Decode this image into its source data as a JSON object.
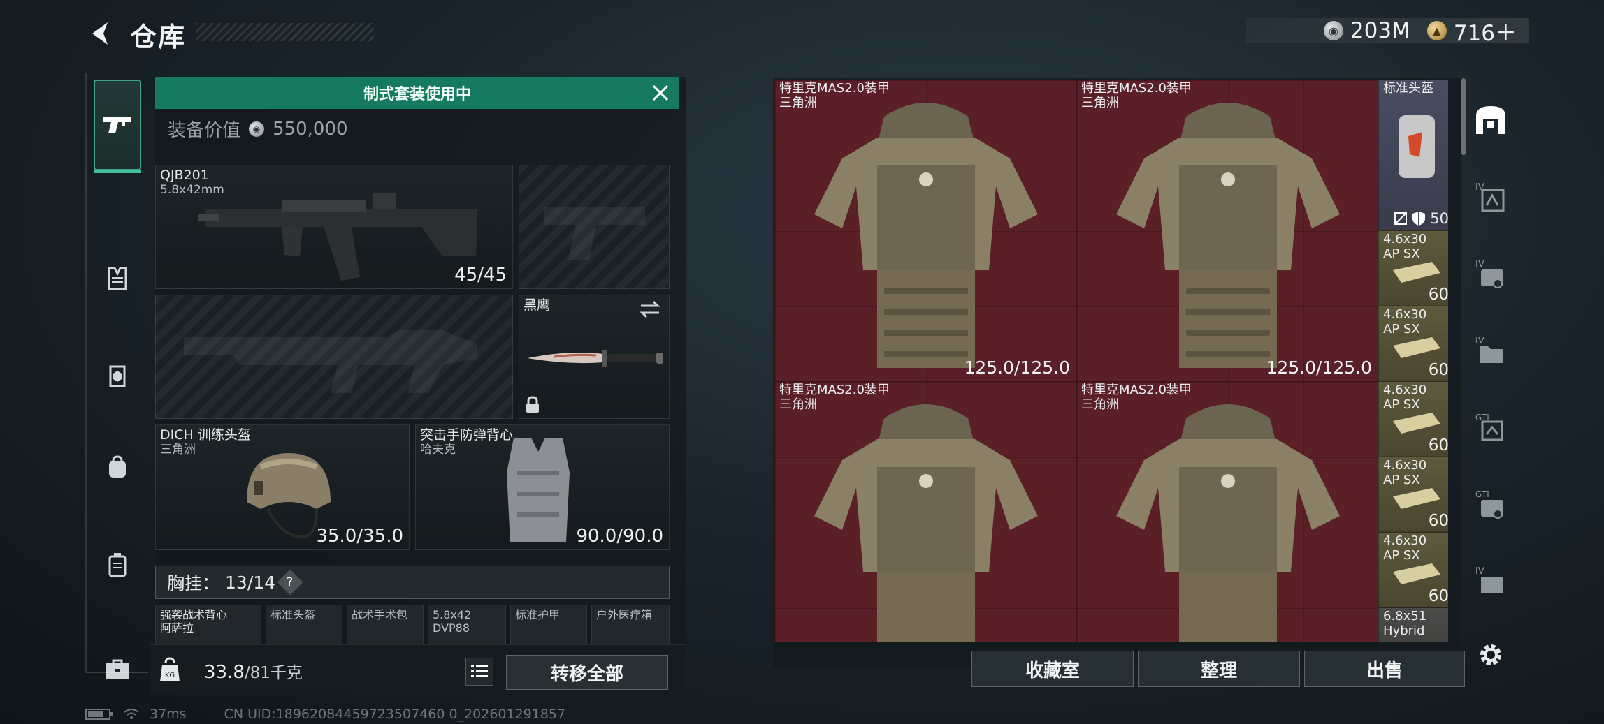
{
  "header": {
    "title": "仓库",
    "currency": [
      {
        "icon": "silver-coin-icon",
        "value": "203M"
      },
      {
        "icon": "gold-coin-icon",
        "value": "716＋"
      }
    ]
  },
  "sidebar": {
    "items": [
      {
        "name": "pistol-icon",
        "active": true
      },
      {
        "name": "vest-icon"
      },
      {
        "name": "armor-icon"
      },
      {
        "name": "backpack-icon"
      },
      {
        "name": "chest-rig-icon"
      },
      {
        "name": "toolbox-icon"
      }
    ]
  },
  "loadout": {
    "banner": "制式套装使用中",
    "value_label": "装备价值",
    "value": "550,000",
    "primary": {
      "name": "QJB201",
      "sub": "5.8x42mm",
      "value": "45/45"
    },
    "knife": {
      "name": "黑鹰"
    },
    "helmet": {
      "name": "DICH 训练头盔",
      "sub": "三角洲",
      "value": "35.0/35.0"
    },
    "armor": {
      "name": "突击手防弹背心",
      "sub": "哈夫克",
      "value": "90.0/90.0"
    },
    "chest_rig": {
      "label": "胸挂：",
      "value": "13/14",
      "help": "?"
    },
    "mini_items": [
      {
        "name": "强袭战术背心",
        "sub": "阿萨拉"
      },
      {
        "name": "标准头盔",
        "sub": ""
      },
      {
        "name": "战术手术包",
        "sub": ""
      },
      {
        "name": "5.8x42",
        "sub": "DVP88"
      },
      {
        "name": "标准护甲",
        "sub": ""
      },
      {
        "name": "户外医疗箱",
        "sub": ""
      }
    ],
    "weight": {
      "current": "33.8",
      "max": "/81千克"
    },
    "transfer_label": "转移全部"
  },
  "storage": {
    "armors": [
      {
        "name": "特里克MAS2.0装甲",
        "sub": "三角洲",
        "value": "125.0/125.0"
      },
      {
        "name": "特里克MAS2.0装甲",
        "sub": "三角洲",
        "value": "125.0/125.0"
      },
      {
        "name": "特里克MAS2.0装甲",
        "sub": "三角洲",
        "value": ""
      },
      {
        "name": "特里克MAS2.0装甲",
        "sub": "三角洲",
        "value": ""
      }
    ],
    "helmet": {
      "name": "标准头盔",
      "durability": "50"
    },
    "ammo": [
      {
        "name": "4.6x30",
        "sub": "AP SX",
        "qty": "60"
      },
      {
        "name": "4.6x30",
        "sub": "AP SX",
        "qty": "60"
      },
      {
        "name": "4.6x30",
        "sub": "AP SX",
        "qty": "60"
      },
      {
        "name": "4.6x30",
        "sub": "AP SX",
        "qty": "60"
      },
      {
        "name": "4.6x30",
        "sub": "AP SX",
        "qty": "60"
      },
      {
        "name": "6.8x51",
        "sub": "Hybrid",
        "qty": ""
      }
    ],
    "buttons": {
      "collection": "收藏室",
      "sort": "整理",
      "sell": "出售"
    }
  },
  "right_sidebar": {
    "items": [
      "safe-box-icon",
      "backpack-tier-IV-icon",
      "case-tier-IV-icon",
      "folder-tier-IV-icon",
      "box-GTI-icon",
      "case-GTI-icon",
      "box-tier-IV-icon",
      "settings-icon"
    ]
  },
  "status": {
    "ping": "37ms",
    "uid": "CN UID:18962084459723507460 0_202601291857"
  },
  "colors": {
    "accent": "#167a60",
    "stash_red": "#5a1f27",
    "ammo_olive": "#5e5a3e",
    "helmet_slate": "#4a4c60"
  }
}
